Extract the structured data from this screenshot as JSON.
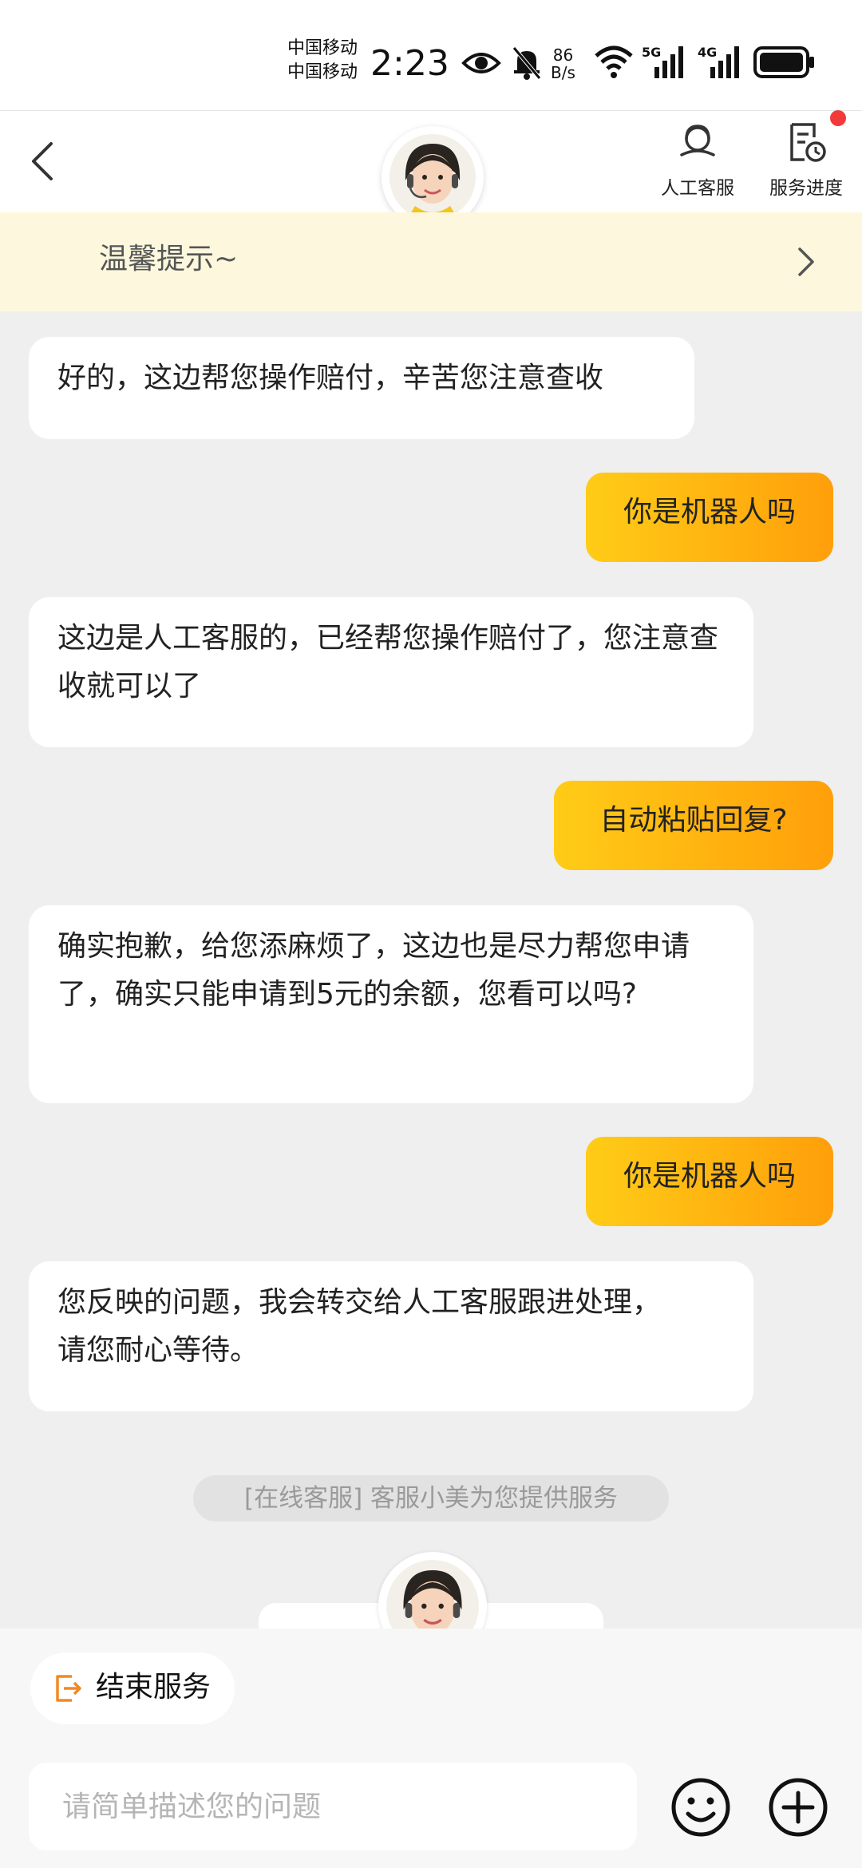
{
  "status_bar": {
    "carrier1": "中国移动",
    "carrier2": "中国移动",
    "time": "2:23",
    "net_speed_value": "86",
    "net_speed_unit": "B/s",
    "signal1_label": "5G",
    "signal2_label": "4G",
    "icons": [
      "eye-icon",
      "bell-off-icon",
      "wifi-icon",
      "signal-icon",
      "battery-icon"
    ]
  },
  "header": {
    "service_button_label": "人工客服",
    "progress_button_label": "服务进度"
  },
  "notice": {
    "text": "温馨提示~"
  },
  "messages": [
    {
      "role": "agent",
      "text": "好的，这边帮您操作赔付，辛苦您注意查收"
    },
    {
      "role": "user",
      "text": "你是机器人吗"
    },
    {
      "role": "agent",
      "text": "这边是人工客服的，已经帮您操作赔付了，您注意查收就可以了"
    },
    {
      "role": "user",
      "text": "自动粘贴回复?"
    },
    {
      "role": "agent",
      "text": "确实抱歉，给您添麻烦了，这边也是尽力帮您申请了，确实只能申请到5元的余额，您看可以吗?"
    },
    {
      "role": "user",
      "text": "你是机器人吗"
    },
    {
      "role": "agent",
      "text": "您反映的问题，我会转交给人工客服跟进处理，请您耐心等待。"
    }
  ],
  "system_note": "[在线客服] 客服小美为您提供服务",
  "bottom": {
    "end_service_label": "结束服务",
    "input_placeholder": "请简单描述您的问题"
  },
  "colors": {
    "accent_start": "#ffcc17",
    "accent_end": "#ff9f0a",
    "notice_bg": "#fdf8dd",
    "page_bg": "#efefef",
    "end_icon": "#f08a24"
  }
}
